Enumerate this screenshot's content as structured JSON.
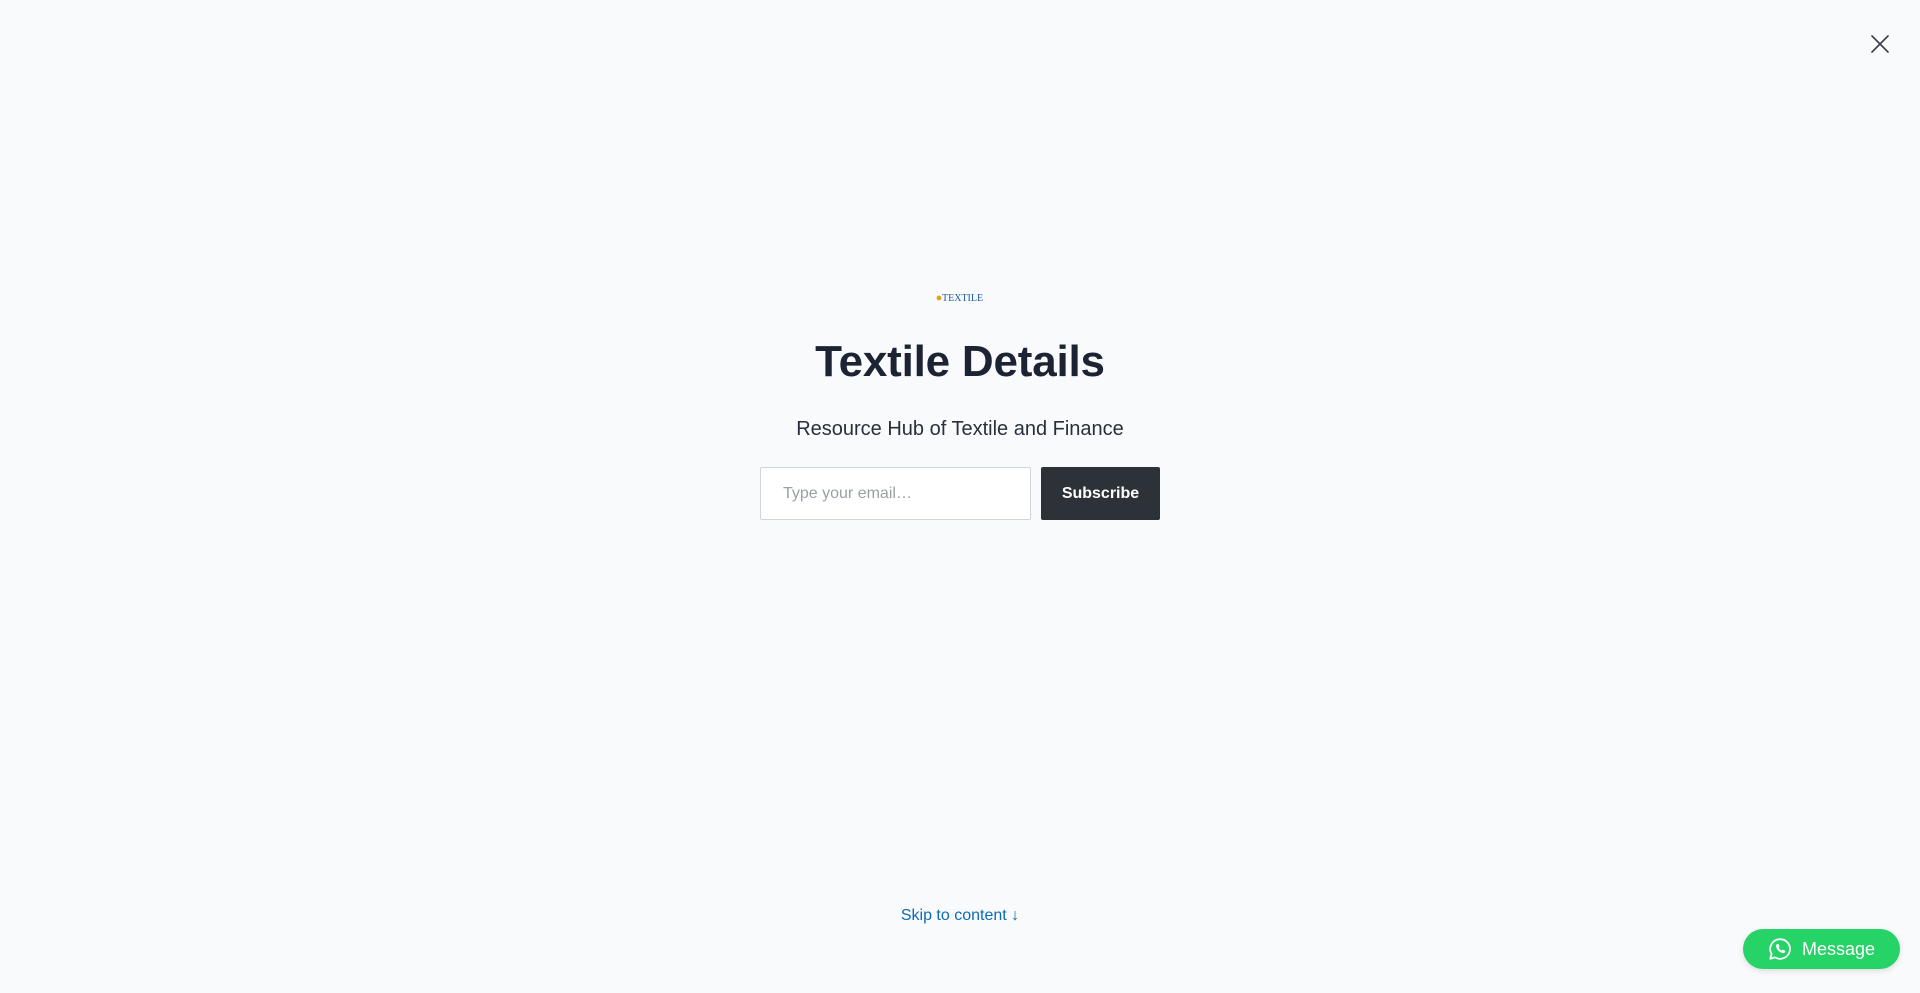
{
  "modal": {
    "close_icon": "close-icon",
    "logo_text": "TEXTILE",
    "title": "Textile Details",
    "subtitle": "Resource Hub of Textile and Finance",
    "email_placeholder": "Type your email…",
    "email_value": "",
    "subscribe_label": "Subscribe"
  },
  "footer": {
    "skip_link": "Skip to content ↓"
  },
  "whatsapp": {
    "icon": "whatsapp-icon",
    "label": "Message"
  },
  "colors": {
    "background": "#f9fafb",
    "title": "#1c2434",
    "button": "#2d3238",
    "link": "#0f6ab4",
    "whatsapp": "#25d366"
  }
}
